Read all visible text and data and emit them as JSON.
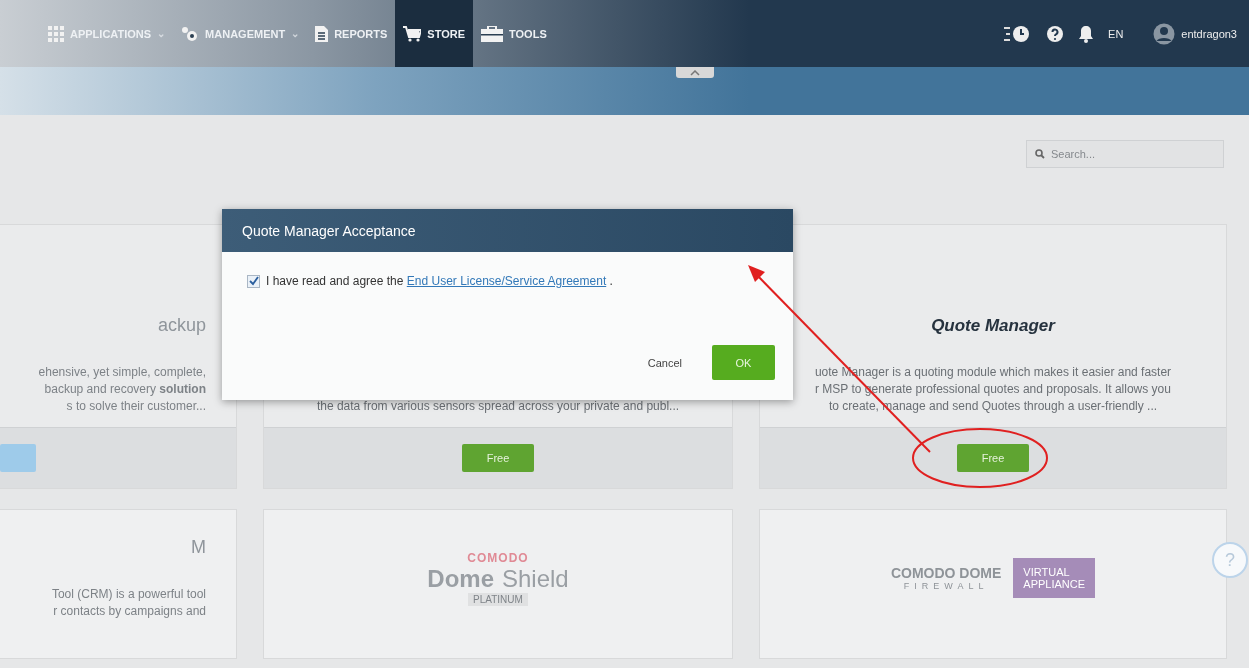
{
  "nav": {
    "items": [
      {
        "label": "APPLICATIONS",
        "caret": "⌄",
        "selected": false
      },
      {
        "label": "MANAGEMENT",
        "caret": "⌄",
        "selected": false
      },
      {
        "label": "REPORTS",
        "selected": false
      },
      {
        "label": "STORE",
        "selected": true
      },
      {
        "label": "TOOLS",
        "selected": false
      }
    ],
    "language": "EN",
    "user": "entdragon3"
  },
  "search": {
    "placeholder": "Search..."
  },
  "cards": [
    {
      "kind": "text",
      "title": "ackup",
      "lines": [
        "ehensive, yet simple, complete,",
        "backup and recovery **solution**",
        "s to solve their customer..."
      ],
      "button": {
        "kind": "blue"
      }
    },
    {
      "kind": "text",
      "lines": [
        "the data from various sensors spread across your private and publ..."
      ],
      "button": {
        "kind": "free",
        "label": "Free"
      }
    },
    {
      "kind": "text",
      "title": "Quote Manager",
      "lines": [
        "uote Manager is a quoting module which makes it easier and faster",
        "r MSP to generate professional quotes and proposals. It allows you",
        "to create, manage and send Quotes through a user-friendly ..."
      ],
      "button": {
        "kind": "free",
        "label": "Free"
      }
    },
    {
      "kind": "text",
      "title": "M",
      "lines": [
        "Tool (CRM) is a powerful tool",
        "r contacts by campaigns and"
      ]
    },
    {
      "kind": "logo",
      "logo": {
        "kind": "dome_shield",
        "brand": "COMODO",
        "word1": "Dome",
        "word2": "Shield",
        "tier": "PLATINUM"
      }
    },
    {
      "kind": "logo",
      "logo": {
        "kind": "dome_firewall",
        "brand": "COMODO DOME",
        "sub": "FIREWALL",
        "badge": [
          "VIRTUAL",
          "APPLIANCE"
        ]
      }
    }
  ],
  "dialog": {
    "title": "Quote Manager Acceptance",
    "checked": true,
    "text": "I have read and agree the",
    "link": "End User License/Service Agreement",
    "after": ".",
    "cancel": "Cancel",
    "ok": "OK"
  },
  "help": {
    "label": "?"
  }
}
